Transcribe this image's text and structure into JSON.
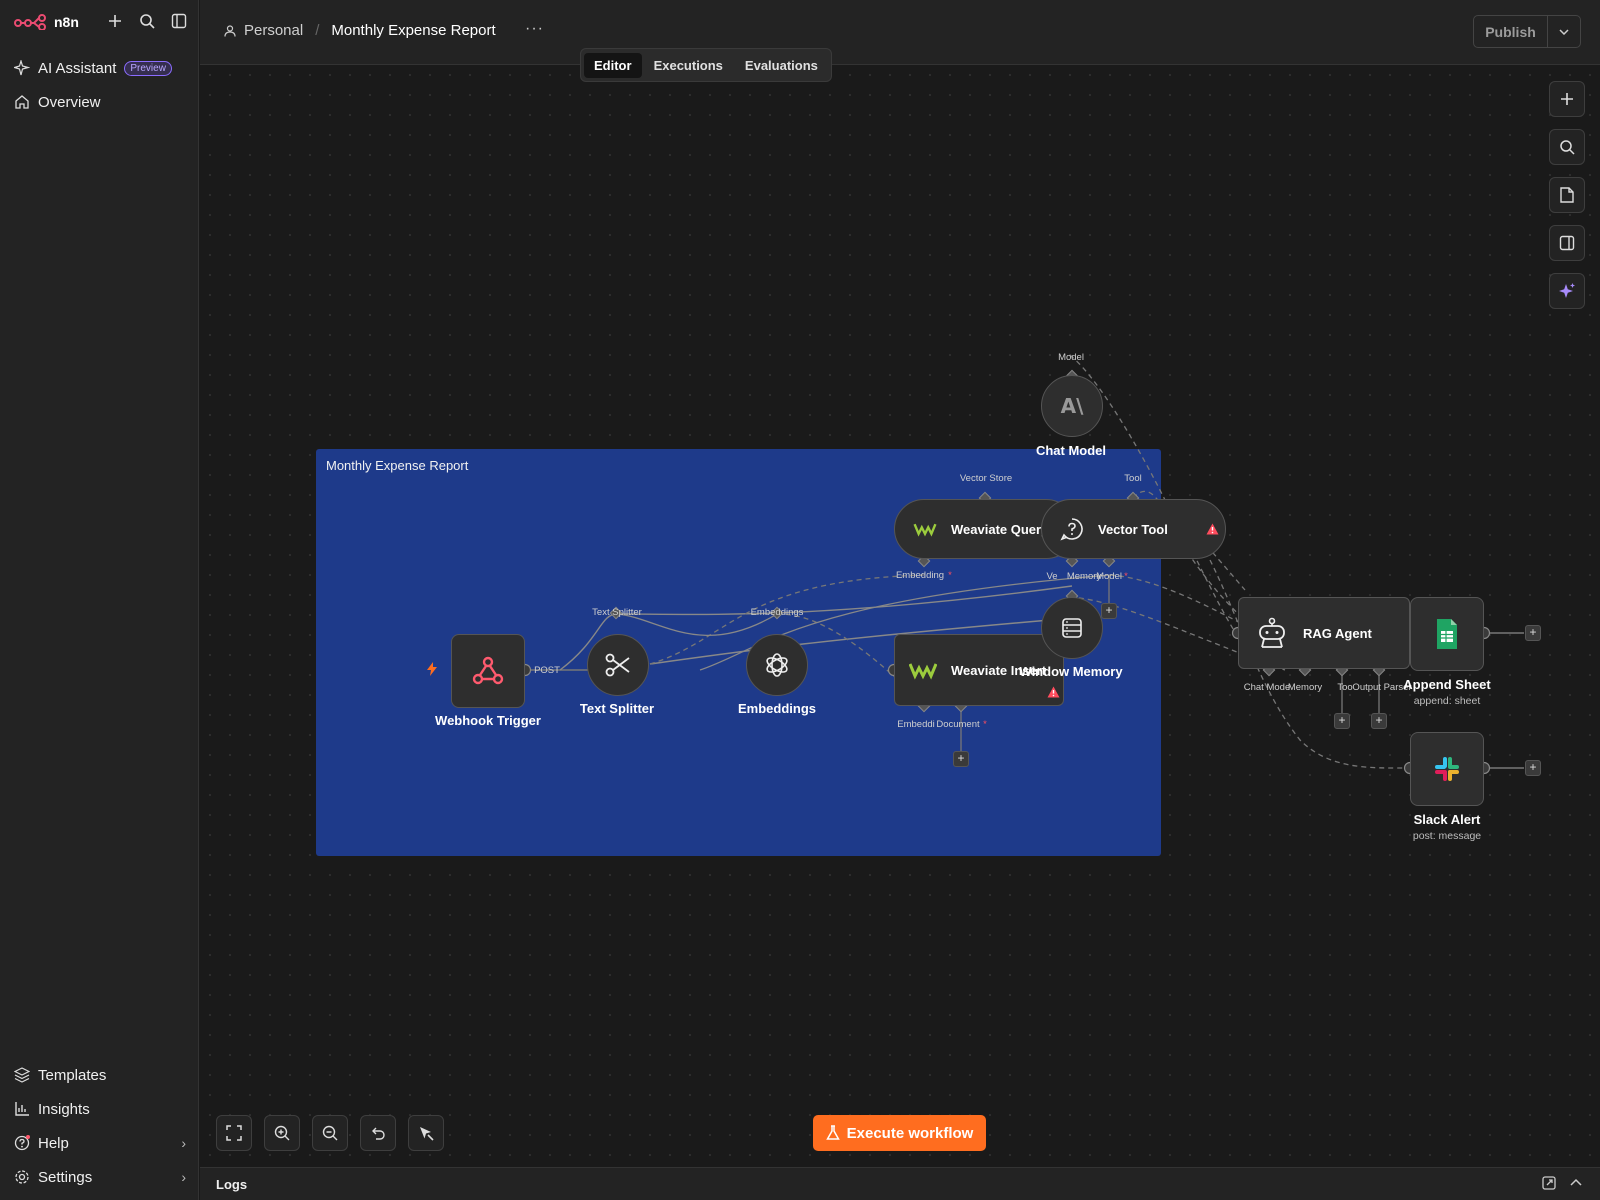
{
  "app": {
    "logo_text": "n8n"
  },
  "sidebar": {
    "top": [
      {
        "label": "AI Assistant",
        "badge": "Preview"
      },
      {
        "label": "Overview"
      }
    ],
    "bottom": [
      {
        "label": "Templates"
      },
      {
        "label": "Insights"
      },
      {
        "label": "Help"
      },
      {
        "label": "Settings"
      }
    ]
  },
  "header": {
    "project": "Personal",
    "workflow_title": "Monthly Expense Report",
    "more": "···",
    "publish_label": "Publish",
    "tabs": [
      {
        "label": "Editor",
        "active": true
      },
      {
        "label": "Executions",
        "active": false
      },
      {
        "label": "Evaluations",
        "active": false
      }
    ]
  },
  "canvas": {
    "sticky_note": "Monthly Expense Report",
    "nodes": {
      "webhook": {
        "label": "Webhook Trigger",
        "port": "POST"
      },
      "splitter": {
        "label": "Text Splitter",
        "top_port": "Text Splitter"
      },
      "embeddings": {
        "label": "Embeddings",
        "top_port": "Embeddings"
      },
      "weaviate_insert": {
        "label": "Weaviate Insert",
        "ports": [
          "Embeddi",
          "Document"
        ]
      },
      "weaviate_query": {
        "label": "Weaviate Query",
        "top_port": "Vector Store",
        "bottom_port": "Embedding"
      },
      "vector_tool": {
        "label": "Vector Tool",
        "top_port": "Tool",
        "bottom_ports": [
          "Ve",
          "Model"
        ]
      },
      "window_memory": {
        "label": "Window Memory",
        "top_port": "Memory"
      },
      "chat_model": {
        "label": "Chat Model",
        "top_port": "Model",
        "icon_text": "A\\"
      },
      "rag_agent": {
        "label": "RAG Agent",
        "ports": [
          "Chat Mode",
          "Memory",
          "Too",
          "Output Parser"
        ]
      },
      "append_sheet": {
        "label": "Append Sheet",
        "sub": "append: sheet"
      },
      "slack_alert": {
        "label": "Slack Alert",
        "sub": "post: message"
      }
    },
    "required_mark": "*"
  },
  "footer": {
    "execute_label": "Execute workflow",
    "logs_label": "Logs"
  },
  "colors": {
    "accent": "#ff6d1f",
    "sticky": "#1e3a8a",
    "webhook_icon": "#ff5a6e",
    "sheets": "#1fa463",
    "ai_spark": "#a78bfa",
    "warning": "#ff4d5e"
  }
}
